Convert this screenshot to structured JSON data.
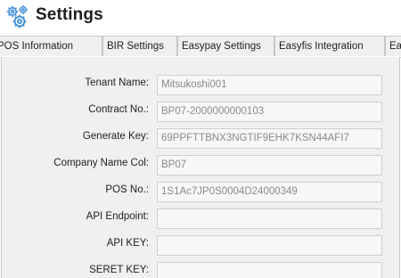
{
  "header": {
    "title": "Settings",
    "icon": "gears-icon",
    "icon_color": "#3f8ed8"
  },
  "tabs": [
    {
      "label": "POS Information",
      "active": false
    },
    {
      "label": "BIR Settings",
      "active": false
    },
    {
      "label": "Easypay Settings",
      "active": false
    },
    {
      "label": "Easyfis Integration",
      "active": false
    },
    {
      "label": "Ea",
      "active": false
    }
  ],
  "form": {
    "tenant_name": {
      "label": "Tenant Name:",
      "value": "Mitsukoshi001"
    },
    "contract_no": {
      "label": "Contract No.:",
      "value": "BP07-2000000000103"
    },
    "generate_key": {
      "label": "Generate Key:",
      "value": "69PPFTTBNX3NGTIF9EHK7KSN44AFI7"
    },
    "company_name_col": {
      "label": "Company Name Col:",
      "value": "BP07"
    },
    "pos_no": {
      "label": "POS No.:",
      "value": "1S1Ac7JP0S0004D24000349"
    },
    "api_endpoint": {
      "label": "API Endpoint:",
      "value": ""
    },
    "api_key": {
      "label": "API KEY:",
      "value": ""
    },
    "seret_key": {
      "label": "SERET KEY:",
      "value": ""
    }
  }
}
